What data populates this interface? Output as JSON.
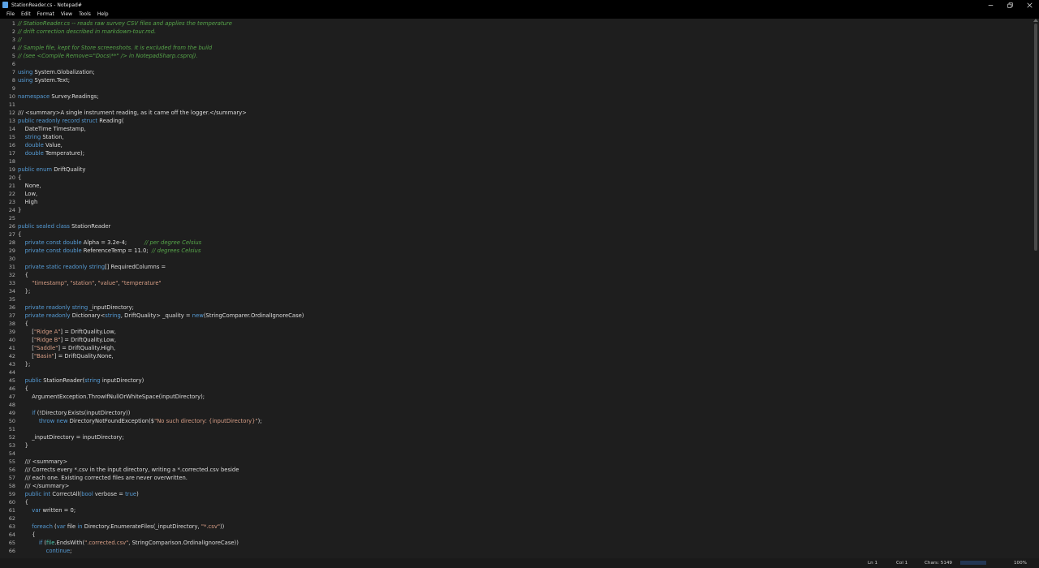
{
  "window": {
    "title": "StationReader.cs - Notepad#"
  },
  "menu": [
    "File",
    "Edit",
    "Format",
    "View",
    "Tools",
    "Help"
  ],
  "lines": [
    {
      "n": "1",
      "t": [
        [
          "cm",
          "// StationReader.cs -- reads raw survey CSV files and applies the temperature"
        ]
      ]
    },
    {
      "n": "2",
      "t": [
        [
          "cm",
          "// drift correction described in markdown-tour.md."
        ]
      ]
    },
    {
      "n": "3",
      "t": [
        [
          "cm",
          "//"
        ]
      ]
    },
    {
      "n": "4",
      "t": [
        [
          "cm",
          "// Sample file, kept for Store screenshots. It is excluded from the build"
        ]
      ]
    },
    {
      "n": "5",
      "t": [
        [
          "cm",
          "// (see <Compile Remove=\"Docs\\**\" /> in NotepadSharp.csproj)."
        ]
      ]
    },
    {
      "n": "6",
      "t": []
    },
    {
      "n": "7",
      "t": [
        [
          "kw",
          "using"
        ],
        [
          "",
          " System.Globalization;"
        ]
      ]
    },
    {
      "n": "8",
      "t": [
        [
          "kw",
          "using"
        ],
        [
          "",
          " System.Text;"
        ]
      ]
    },
    {
      "n": "9",
      "t": []
    },
    {
      "n": "10",
      "t": [
        [
          "kw",
          "namespace"
        ],
        [
          "",
          " Survey.Readings;"
        ]
      ]
    },
    {
      "n": "11",
      "t": []
    },
    {
      "n": "12",
      "t": [
        [
          "",
          "/// <summary>A single instrument reading, as it came off the logger.</summary>"
        ]
      ]
    },
    {
      "n": "13",
      "t": [
        [
          "kw",
          "public"
        ],
        [
          "",
          " "
        ],
        [
          "kw",
          "readonly"
        ],
        [
          "",
          " "
        ],
        [
          "kw",
          "record"
        ],
        [
          "",
          " "
        ],
        [
          "kw",
          "struct"
        ],
        [
          "",
          " Reading("
        ]
      ]
    },
    {
      "n": "14",
      "t": [
        [
          "",
          "    DateTime Timestamp,"
        ]
      ]
    },
    {
      "n": "15",
      "t": [
        [
          "",
          "    "
        ],
        [
          "kw",
          "string"
        ],
        [
          "",
          " Station,"
        ]
      ]
    },
    {
      "n": "16",
      "t": [
        [
          "",
          "    "
        ],
        [
          "kw",
          "double"
        ],
        [
          "",
          " Value,"
        ]
      ]
    },
    {
      "n": "17",
      "t": [
        [
          "",
          "    "
        ],
        [
          "kw",
          "double"
        ],
        [
          "",
          " Temperature);"
        ]
      ]
    },
    {
      "n": "18",
      "t": []
    },
    {
      "n": "19",
      "t": [
        [
          "kw",
          "public"
        ],
        [
          "",
          " "
        ],
        [
          "kw",
          "enum"
        ],
        [
          "",
          " DriftQuality"
        ]
      ]
    },
    {
      "n": "20",
      "t": [
        [
          "",
          "{"
        ]
      ]
    },
    {
      "n": "21",
      "t": [
        [
          "",
          "    None,"
        ]
      ]
    },
    {
      "n": "22",
      "t": [
        [
          "",
          "    Low,"
        ]
      ]
    },
    {
      "n": "23",
      "t": [
        [
          "",
          "    High"
        ]
      ]
    },
    {
      "n": "24",
      "t": [
        [
          "",
          "}"
        ]
      ]
    },
    {
      "n": "25",
      "t": []
    },
    {
      "n": "26",
      "t": [
        [
          "kw",
          "public"
        ],
        [
          "",
          " "
        ],
        [
          "kw",
          "sealed"
        ],
        [
          "",
          " "
        ],
        [
          "kw",
          "class"
        ],
        [
          "",
          " StationReader"
        ]
      ]
    },
    {
      "n": "27",
      "t": [
        [
          "",
          "{"
        ]
      ]
    },
    {
      "n": "28",
      "t": [
        [
          "",
          "    "
        ],
        [
          "kw",
          "private"
        ],
        [
          "",
          " "
        ],
        [
          "kw",
          "const"
        ],
        [
          "",
          " "
        ],
        [
          "kw",
          "double"
        ],
        [
          "",
          " Alpha = 3.2e-4;          "
        ],
        [
          "cm",
          "// per degree Celsius"
        ]
      ]
    },
    {
      "n": "29",
      "t": [
        [
          "",
          "    "
        ],
        [
          "kw",
          "private"
        ],
        [
          "",
          " "
        ],
        [
          "kw",
          "const"
        ],
        [
          "",
          " "
        ],
        [
          "kw",
          "double"
        ],
        [
          "",
          " ReferenceTemp = 11.0;  "
        ],
        [
          "cm",
          "// degrees Celsius"
        ]
      ]
    },
    {
      "n": "30",
      "t": []
    },
    {
      "n": "31",
      "t": [
        [
          "",
          "    "
        ],
        [
          "kw",
          "private"
        ],
        [
          "",
          " "
        ],
        [
          "kw",
          "static"
        ],
        [
          "",
          " "
        ],
        [
          "kw",
          "readonly"
        ],
        [
          "",
          " "
        ],
        [
          "kw",
          "string"
        ],
        [
          "",
          "[] RequiredColumns ="
        ]
      ]
    },
    {
      "n": "32",
      "t": [
        [
          "",
          "    {"
        ]
      ]
    },
    {
      "n": "33",
      "t": [
        [
          "",
          "        "
        ],
        [
          "st",
          "\"timestamp\""
        ],
        [
          "",
          ", "
        ],
        [
          "st",
          "\"station\""
        ],
        [
          "",
          ", "
        ],
        [
          "st",
          "\"value\""
        ],
        [
          "",
          ", "
        ],
        [
          "st",
          "\"temperature\""
        ]
      ]
    },
    {
      "n": "34",
      "t": [
        [
          "",
          "    };"
        ]
      ]
    },
    {
      "n": "35",
      "t": []
    },
    {
      "n": "36",
      "t": [
        [
          "",
          "    "
        ],
        [
          "kw",
          "private"
        ],
        [
          "",
          " "
        ],
        [
          "kw",
          "readonly"
        ],
        [
          "",
          " "
        ],
        [
          "kw",
          "string"
        ],
        [
          "",
          " _inputDirectory;"
        ]
      ]
    },
    {
      "n": "37",
      "t": [
        [
          "",
          "    "
        ],
        [
          "kw",
          "private"
        ],
        [
          "",
          " "
        ],
        [
          "kw",
          "readonly"
        ],
        [
          "",
          " Dictionary<"
        ],
        [
          "kw",
          "string"
        ],
        [
          "",
          ", DriftQuality> _quality = "
        ],
        [
          "kw",
          "new"
        ],
        [
          "",
          "(StringComparer.OrdinalIgnoreCase)"
        ]
      ]
    },
    {
      "n": "38",
      "t": [
        [
          "",
          "    {"
        ]
      ]
    },
    {
      "n": "39",
      "t": [
        [
          "",
          "        ["
        ],
        [
          "st",
          "\"Ridge A\""
        ],
        [
          "",
          "] = DriftQuality.Low,"
        ]
      ]
    },
    {
      "n": "40",
      "t": [
        [
          "",
          "        ["
        ],
        [
          "st",
          "\"Ridge B\""
        ],
        [
          "",
          "] = DriftQuality.Low,"
        ]
      ]
    },
    {
      "n": "41",
      "t": [
        [
          "",
          "        ["
        ],
        [
          "st",
          "\"Saddle\""
        ],
        [
          "",
          "] = DriftQuality.High,"
        ]
      ]
    },
    {
      "n": "42",
      "t": [
        [
          "",
          "        ["
        ],
        [
          "st",
          "\"Basin\""
        ],
        [
          "",
          "] = DriftQuality.None,"
        ]
      ]
    },
    {
      "n": "43",
      "t": [
        [
          "",
          "    };"
        ]
      ]
    },
    {
      "n": "44",
      "t": []
    },
    {
      "n": "45",
      "t": [
        [
          "",
          "    "
        ],
        [
          "kw",
          "public"
        ],
        [
          "",
          " StationReader("
        ],
        [
          "kw",
          "string"
        ],
        [
          "",
          " inputDirectory)"
        ]
      ]
    },
    {
      "n": "46",
      "t": [
        [
          "",
          "    {"
        ]
      ]
    },
    {
      "n": "47",
      "t": [
        [
          "",
          "        ArgumentException.ThrowIfNullOrWhiteSpace(inputDirectory);"
        ]
      ]
    },
    {
      "n": "48",
      "t": []
    },
    {
      "n": "49",
      "t": [
        [
          "",
          "        "
        ],
        [
          "kw",
          "if"
        ],
        [
          "",
          " (!Directory.Exists(inputDirectory))"
        ]
      ]
    },
    {
      "n": "50",
      "t": [
        [
          "",
          "            "
        ],
        [
          "kw",
          "throw"
        ],
        [
          "",
          " "
        ],
        [
          "kw",
          "new"
        ],
        [
          "",
          " DirectoryNotFoundException($"
        ],
        [
          "st",
          "\"No such directory: {inputDirectory}\""
        ],
        [
          "",
          ");"
        ]
      ]
    },
    {
      "n": "51",
      "t": []
    },
    {
      "n": "52",
      "t": [
        [
          "",
          "        _inputDirectory = inputDirectory;"
        ]
      ]
    },
    {
      "n": "53",
      "t": [
        [
          "",
          "    }"
        ]
      ]
    },
    {
      "n": "54",
      "t": []
    },
    {
      "n": "55",
      "t": [
        [
          "",
          "    /// <summary>"
        ]
      ]
    },
    {
      "n": "56",
      "t": [
        [
          "",
          "    /// Corrects every *.csv in the input directory, writing a *.corrected.csv beside"
        ]
      ]
    },
    {
      "n": "57",
      "t": [
        [
          "",
          "    /// each one. Existing corrected files are never overwritten."
        ]
      ]
    },
    {
      "n": "58",
      "t": [
        [
          "",
          "    /// </summary>"
        ]
      ]
    },
    {
      "n": "59",
      "t": [
        [
          "",
          "    "
        ],
        [
          "kw",
          "public"
        ],
        [
          "",
          " "
        ],
        [
          "kw",
          "int"
        ],
        [
          "",
          " CorrectAll("
        ],
        [
          "kw",
          "bool"
        ],
        [
          "",
          " verbose = "
        ],
        [
          "kw",
          "true"
        ],
        [
          "",
          ")"
        ]
      ]
    },
    {
      "n": "60",
      "t": [
        [
          "",
          "    {"
        ]
      ]
    },
    {
      "n": "61",
      "t": [
        [
          "",
          "        "
        ],
        [
          "kw",
          "var"
        ],
        [
          "",
          " written = 0;"
        ]
      ]
    },
    {
      "n": "62",
      "t": []
    },
    {
      "n": "63",
      "t": [
        [
          "",
          "        "
        ],
        [
          "kw",
          "foreach"
        ],
        [
          "",
          " ("
        ],
        [
          "kw",
          "var"
        ],
        [
          "",
          " file "
        ],
        [
          "kw",
          "in"
        ],
        [
          "",
          " Directory.EnumerateFiles(_inputDirectory, "
        ],
        [
          "st",
          "\"*.csv\""
        ],
        [
          "",
          "))"
        ]
      ]
    },
    {
      "n": "64",
      "t": [
        [
          "",
          "        {"
        ]
      ]
    },
    {
      "n": "65",
      "t": [
        [
          "",
          "            "
        ],
        [
          "kw",
          "if"
        ],
        [
          "",
          " ("
        ],
        [
          "ty",
          "file"
        ],
        [
          "",
          ".EndsWith("
        ],
        [
          "st",
          "\".corrected.csv\""
        ],
        [
          "",
          ", StringComparison.OrdinalIgnoreCase))"
        ]
      ]
    },
    {
      "n": "66",
      "t": [
        [
          "",
          "                "
        ],
        [
          "kw",
          "continue"
        ],
        [
          "",
          ";"
        ]
      ]
    }
  ],
  "status": {
    "line": "Ln 1",
    "col": "Col 1",
    "chars": "Chars: 5149",
    "zoom": "100%"
  },
  "icons": {
    "minimize": "minimize-icon",
    "maximize": "restore-icon",
    "close": "close-icon"
  }
}
